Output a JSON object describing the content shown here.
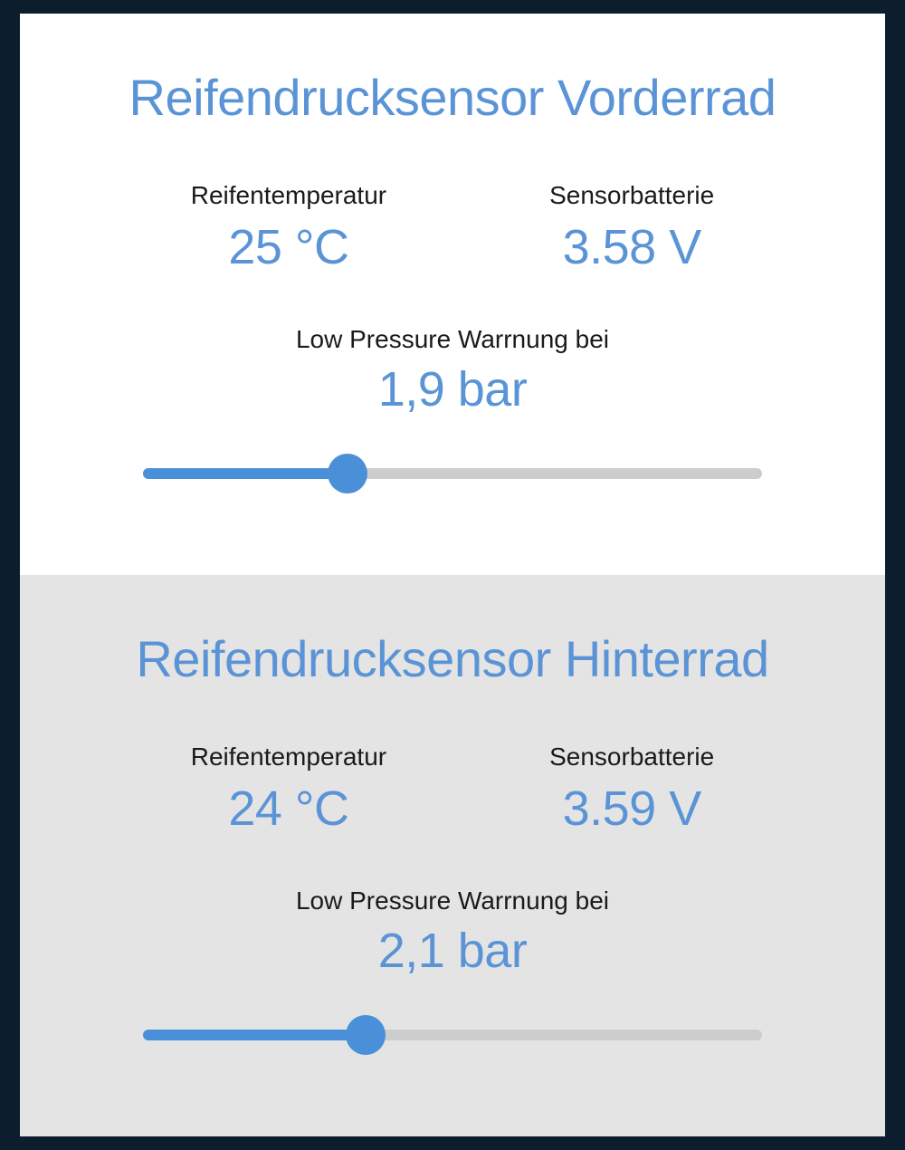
{
  "front": {
    "title": "Reifendrucksensor Vorderrad",
    "temperature": {
      "label": "Reifentemperatur",
      "value": "25 °C"
    },
    "battery": {
      "label": "Sensorbatterie",
      "value": "3.58 V"
    },
    "warning": {
      "label": "Low Pressure Warrnung bei",
      "value": "1,9 bar",
      "slider_percent": 33
    }
  },
  "rear": {
    "title": "Reifendrucksensor Hinterrad",
    "temperature": {
      "label": "Reifentemperatur",
      "value": "24 °C"
    },
    "battery": {
      "label": "Sensorbatterie",
      "value": "3.59 V"
    },
    "warning": {
      "label": "Low Pressure Warrnung bei",
      "value": "2,1 bar",
      "slider_percent": 36
    }
  },
  "colors": {
    "accent": "#5b94d6",
    "slider_fill": "#4a90d9",
    "slider_track": "#cdcdcd",
    "bg_dark": "#0c1e2e",
    "bg_panel_alt": "#e4e4e4"
  }
}
